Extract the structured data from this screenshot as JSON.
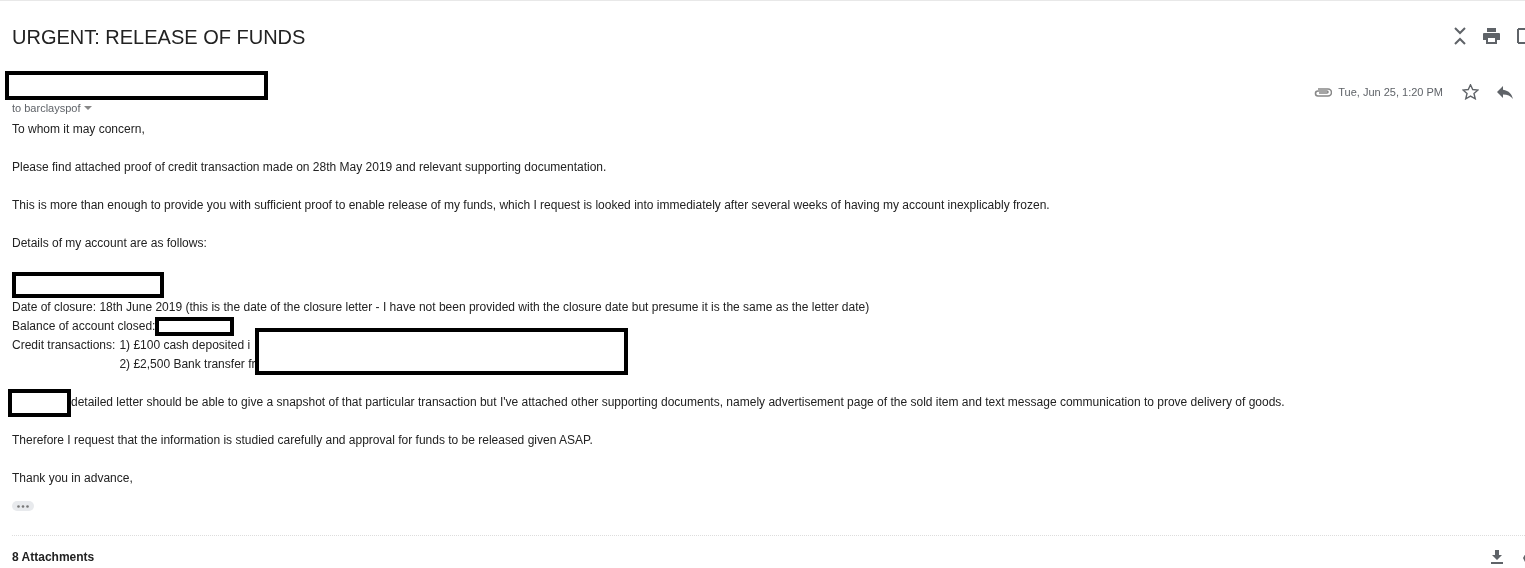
{
  "subject": "URGENT: RELEASE OF FUNDS",
  "sender": {
    "redacted": true,
    "recipient": "to barclayspof"
  },
  "meta": {
    "date": "Tue, Jun 25, 1:20 PM",
    "has_attachment": true,
    "starred": false
  },
  "body": [
    [
      [
        {
          "kind": "text",
          "text": "To whom it may concern,"
        }
      ]
    ],
    [
      [
        {
          "kind": "text",
          "text": "Please find attached proof of credit transaction made on 28th May 2019 and relevant supporting documentation."
        }
      ]
    ],
    [
      [
        {
          "kind": "text",
          "text": "This is more than enough to provide you with sufficient proof to enable release of my funds, which I request is looked into immediately after several weeks of having my account inexplicably frozen."
        }
      ]
    ],
    [
      [
        {
          "kind": "text",
          "text": "Details of my account are as follows:"
        }
      ]
    ],
    [
      [
        {
          "kind": "redaction"
        }
      ],
      [
        {
          "kind": "text",
          "text": "Date of closure: 18th June 2019 (this is the date of the closure letter - I have not been provided with the closure date but presume it is the same as the letter date)"
        }
      ],
      [
        {
          "kind": "text",
          "text": "Balance of account closed:"
        },
        {
          "kind": "redaction"
        }
      ],
      [
        {
          "kind": "transactions",
          "label": "Credit transactions:",
          "items": [
            "1) £100 cash deposited i",
            "2) £2,500 Bank transfer fr"
          ]
        }
      ]
    ],
    [
      [
        {
          "kind": "redaction"
        },
        {
          "kind": "text",
          "text": "detailed letter should be able to give a snapshot of that particular transaction but I've attached other supporting documents, namely advertisement page of the sold item and text message communication to prove delivery of goods."
        }
      ]
    ],
    [
      [
        {
          "kind": "text",
          "text": "Therefore I request that the information is studied carefully and approval for funds to be released given ASAP."
        }
      ]
    ],
    [
      [
        {
          "kind": "text",
          "text": "Thank you in advance,"
        }
      ]
    ]
  ],
  "attachments": {
    "title": "8 Attachments"
  }
}
